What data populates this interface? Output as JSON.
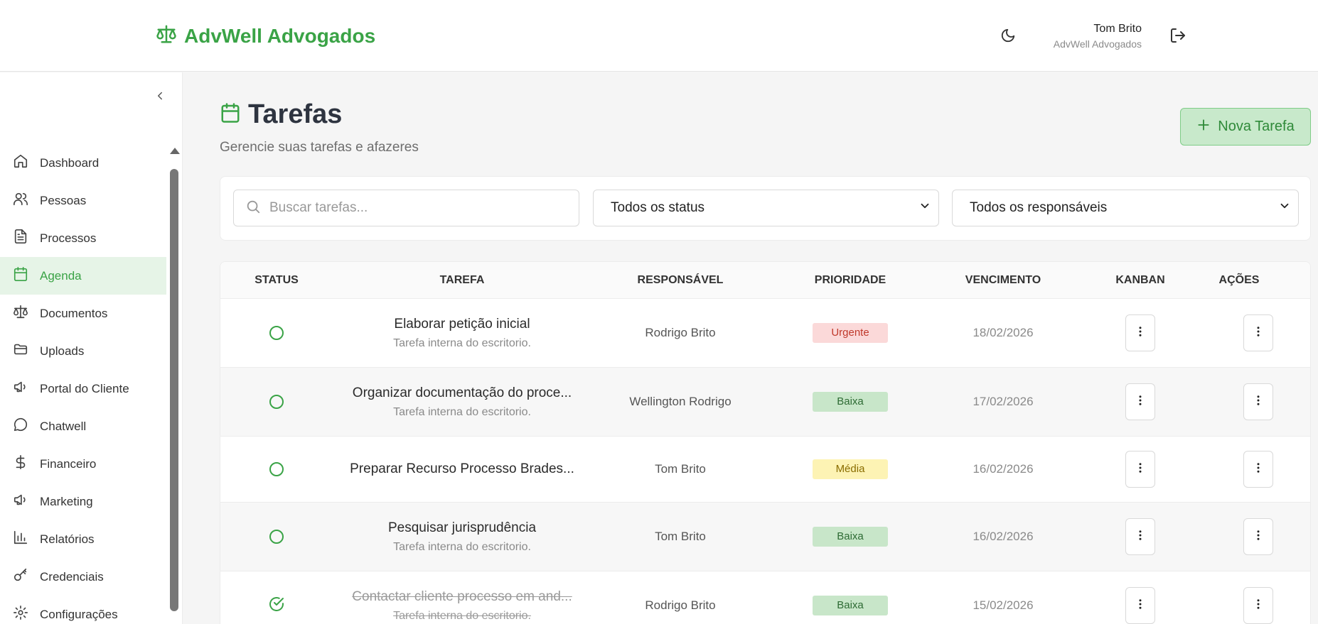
{
  "brand": {
    "name": "AdvWell Advogados",
    "color": "#3aa346",
    "icon": "scale-icon"
  },
  "user": {
    "name": "Tom Brito",
    "org": "AdvWell Advogados"
  },
  "sidebar": {
    "items": [
      {
        "label": "Dashboard",
        "icon": "home-icon"
      },
      {
        "label": "Pessoas",
        "icon": "users-icon"
      },
      {
        "label": "Processos",
        "icon": "file-icon"
      },
      {
        "label": "Agenda",
        "icon": "calendar-icon",
        "active": true
      },
      {
        "label": "Documentos",
        "icon": "scale-icon"
      },
      {
        "label": "Uploads",
        "icon": "folder-icon"
      },
      {
        "label": "Portal do Cliente",
        "icon": "megaphone-icon"
      },
      {
        "label": "Chatwell",
        "icon": "chat-icon"
      },
      {
        "label": "Financeiro",
        "icon": "dollar-icon"
      },
      {
        "label": "Marketing",
        "icon": "megaphone-icon"
      },
      {
        "label": "Relatórios",
        "icon": "bar-chart-icon"
      },
      {
        "label": "Credenciais",
        "icon": "key-icon"
      },
      {
        "label": "Configurações",
        "icon": "gear-icon"
      }
    ]
  },
  "page": {
    "title": "Tarefas",
    "subtitle": "Gerencie suas tarefas e afazeres",
    "new_button": "Nova Tarefa"
  },
  "filters": {
    "search_placeholder": "Buscar tarefas...",
    "status_selected": "Todos os status",
    "responsible_selected": "Todos os responsáveis"
  },
  "table": {
    "headers": {
      "status": "STATUS",
      "task": "TAREFA",
      "responsible": "RESPONSÁVEL",
      "priority": "PRIORIDADE",
      "due": "VENCIMENTO",
      "kanban": "KANBAN",
      "actions": "AÇÕES"
    },
    "rows": [
      {
        "title": "Elaborar petição inicial",
        "desc": "Tarefa interna do escritorio.",
        "responsible": "Rodrigo Brito",
        "priority": "Urgente",
        "due": "18/02/2026",
        "done": false
      },
      {
        "title": "Organizar documentação do proce...",
        "desc": "Tarefa interna do escritorio.",
        "responsible": "Wellington Rodrigo",
        "priority": "Baixa",
        "due": "17/02/2026",
        "done": false
      },
      {
        "title": "Preparar Recurso Processo Brades...",
        "desc": "",
        "responsible": "Tom Brito",
        "priority": "Média",
        "due": "16/02/2026",
        "done": false
      },
      {
        "title": "Pesquisar jurisprudência",
        "desc": "Tarefa interna do escritorio.",
        "responsible": "Tom Brito",
        "priority": "Baixa",
        "due": "16/02/2026",
        "done": false
      },
      {
        "title": "Contactar cliente processo em and...",
        "desc": "Tarefa interna do escritorio.",
        "responsible": "Rodrigo Brito",
        "priority": "Baixa",
        "due": "15/02/2026",
        "done": true
      }
    ]
  },
  "colors": {
    "accent": "#3aa346",
    "urgent": "#fbd9d9",
    "low": "#c8e6c9",
    "medium": "#fdf3b4"
  }
}
